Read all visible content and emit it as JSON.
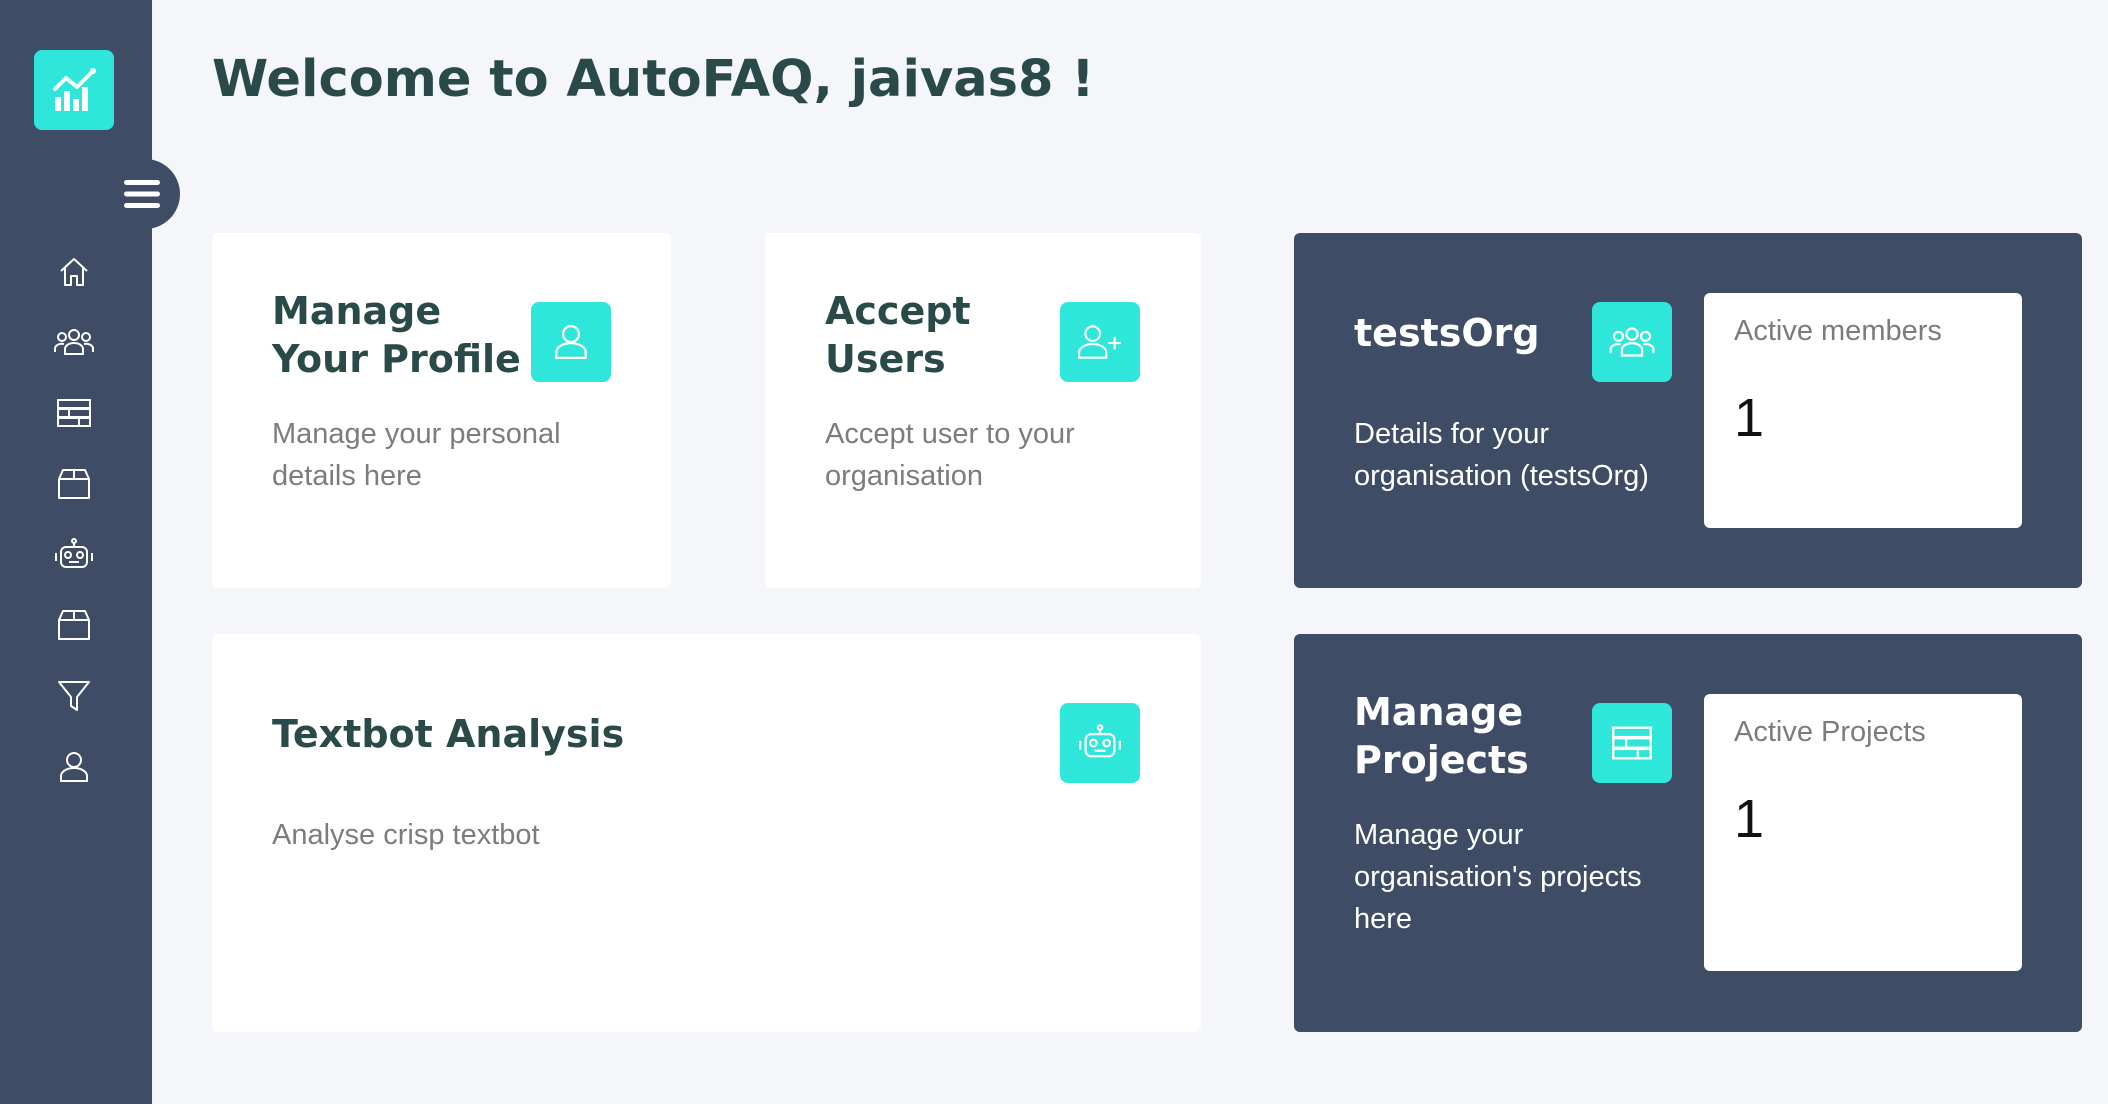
{
  "welcome": {
    "title": "Welcome to AutoFAQ, jaivas8 !"
  },
  "sidebar": {
    "logo_icon": "analytics-chart-icon",
    "toggle_icon": "hamburger-menu-icon",
    "items": [
      {
        "icon": "home-icon"
      },
      {
        "icon": "users-group-icon"
      },
      {
        "icon": "table-list-icon"
      },
      {
        "icon": "box-icon"
      },
      {
        "icon": "robot-icon"
      },
      {
        "icon": "box-icon"
      },
      {
        "icon": "filter-icon"
      },
      {
        "icon": "user-icon"
      }
    ]
  },
  "cards": {
    "profile": {
      "title_line1": "Manage",
      "title_line2": "Your Profile",
      "desc_line1": "Manage your personal",
      "desc_line2": "details here",
      "icon": "user-icon"
    },
    "accept": {
      "title_line1": "Accept",
      "title_line2": "Users",
      "desc_line1": "Accept user to your",
      "desc_line2": "organisation",
      "icon": "user-add-icon"
    },
    "org": {
      "title": "testsOrg",
      "desc_line1": "Details for your",
      "desc_line2": "organisation (testsOrg)",
      "icon": "users-group-icon",
      "stat_label": "Active members",
      "stat_value": "1"
    },
    "textbot": {
      "title": "Textbot Analysis",
      "desc": "Analyse crisp textbot",
      "icon": "robot-icon"
    },
    "projects": {
      "title_line1": "Manage",
      "title_line2": "Projects",
      "desc_line1": "Manage your",
      "desc_line2": "organisation's projects",
      "desc_line3": "here",
      "icon": "table-list-icon",
      "stat_label": "Active Projects",
      "stat_value": "1"
    }
  },
  "colors": {
    "sidebar": "#3f4c66",
    "accent": "#2ee6d9",
    "heading": "#2a4a4a",
    "background": "#f4f6f9"
  }
}
